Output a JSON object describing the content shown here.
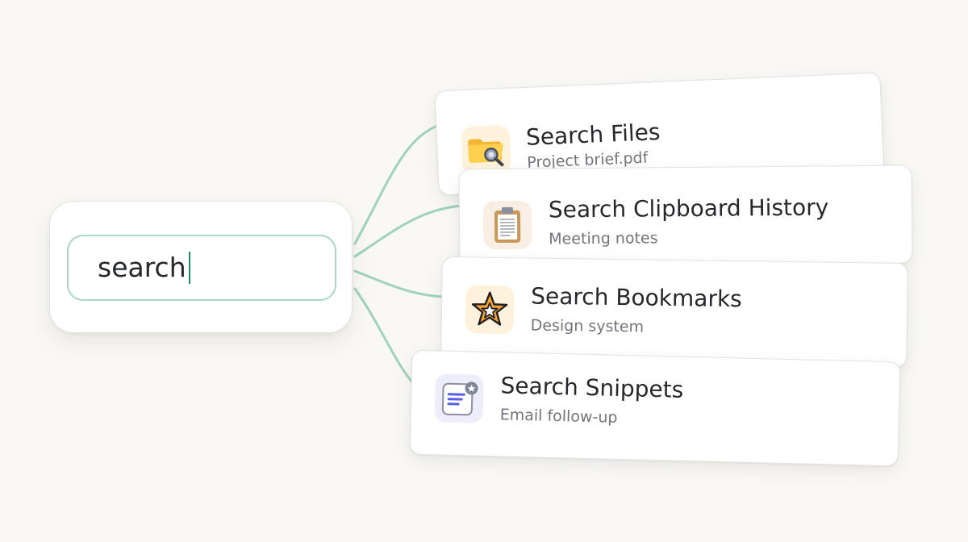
{
  "search": {
    "value": "search"
  },
  "results": [
    {
      "title": "Search Files",
      "subtitle": "Project brief.pdf",
      "icon": "folder-search-icon",
      "tile_color": "#fff2dc"
    },
    {
      "title": "Search Clipboard History",
      "subtitle": "Meeting notes",
      "icon": "clipboard-icon",
      "tile_color": "#f8eee4"
    },
    {
      "title": "Search Bookmarks",
      "subtitle": "Design system",
      "icon": "star-icon",
      "tile_color": "#fff2dc"
    },
    {
      "title": "Search Snippets",
      "subtitle": "Email follow-up",
      "icon": "snippet-icon",
      "tile_color": "#eeeefb"
    }
  ],
  "colors": {
    "background": "#f9f8f4",
    "connector": "#9fd3ba",
    "input_border": "#a9d8c2",
    "caret": "#1d8f63"
  }
}
